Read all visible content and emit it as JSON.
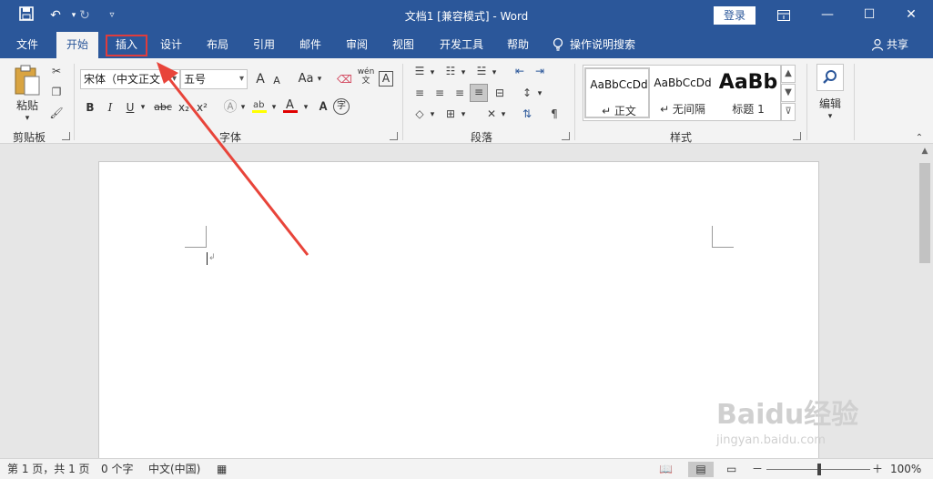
{
  "title_bar": {
    "title": "文档1 [兼容模式] - Word",
    "login_label": "登录",
    "qat": [
      "save-icon",
      "undo-icon",
      "redo-icon",
      "customize-icon"
    ],
    "window_controls": [
      "ribbon-display-icon",
      "minimize-icon",
      "maximize-icon",
      "close-icon"
    ]
  },
  "tabs": [
    {
      "label": "文件"
    },
    {
      "label": "开始",
      "active": true
    },
    {
      "label": "插入"
    },
    {
      "label": "设计"
    },
    {
      "label": "布局"
    },
    {
      "label": "引用"
    },
    {
      "label": "邮件"
    },
    {
      "label": "审阅"
    },
    {
      "label": "视图"
    },
    {
      "label": "开发工具"
    },
    {
      "label": "帮助"
    }
  ],
  "tell_me": "操作说明搜索",
  "share_label": "共享",
  "ribbon": {
    "clipboard": {
      "label": "剪贴板",
      "paste_label": "粘贴"
    },
    "font": {
      "label": "字体",
      "font_name": "宋体（中文正文",
      "font_size": "五号",
      "grow": "A",
      "shrink": "A",
      "case": "Aa",
      "bold": "B",
      "italic": "I",
      "underline": "U",
      "strike": "abc",
      "subscript": "x₂",
      "superscript": "x²",
      "phonetic": "wén",
      "border_char": "A",
      "enclose_char": "字"
    },
    "paragraph": {
      "label": "段落"
    },
    "styles": {
      "label": "样式",
      "items": [
        {
          "sample": "AaBbCcDd",
          "name": "↵ 正文"
        },
        {
          "sample": "AaBbCcDd",
          "name": "↵ 无间隔"
        },
        {
          "sample": "AaBb",
          "name": "标题 1"
        }
      ]
    },
    "editing": {
      "label": "编辑"
    }
  },
  "status_bar": {
    "page": "第 1 页，共 1 页",
    "words": "0 个字",
    "language": "中文(中国)",
    "zoom": "100%",
    "zoom_minus": "－",
    "zoom_plus": "＋"
  },
  "watermark": {
    "text": "Baidu经验",
    "sub": "jingyan.baidu.com"
  },
  "colors": {
    "brand": "#2b579a",
    "annotation": "#e03c3c"
  }
}
